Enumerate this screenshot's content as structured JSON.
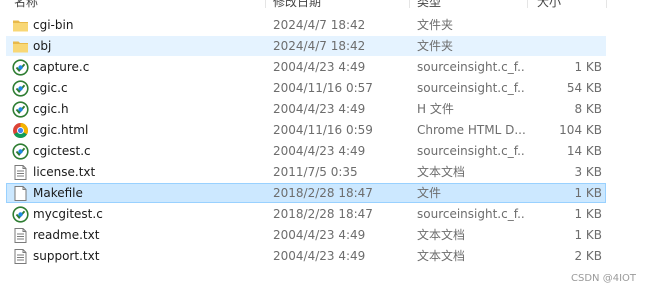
{
  "header": {
    "name": "名称",
    "date": "修改日期",
    "type": "类型",
    "size": "大小"
  },
  "files": [
    {
      "name": "cgi-bin",
      "date": "2024/4/7 18:42",
      "type": "文件夹",
      "size": "",
      "icon": "folder-icon"
    },
    {
      "name": "obj",
      "date": "2024/4/7 18:42",
      "type": "文件夹",
      "size": "",
      "icon": "folder-icon",
      "state": "hover"
    },
    {
      "name": "capture.c",
      "date": "2004/4/23 4:49",
      "type": "sourceinsight.c_f...",
      "size": "1 KB",
      "icon": "source-file-icon"
    },
    {
      "name": "cgic.c",
      "date": "2004/11/16 0:57",
      "type": "sourceinsight.c_f...",
      "size": "54 KB",
      "icon": "source-file-icon"
    },
    {
      "name": "cgic.h",
      "date": "2004/4/23 4:49",
      "type": "H 文件",
      "size": "8 KB",
      "icon": "source-file-icon"
    },
    {
      "name": "cgic.html",
      "date": "2004/11/16 0:59",
      "type": "Chrome HTML D...",
      "size": "104 KB",
      "icon": "chrome-icon"
    },
    {
      "name": "cgictest.c",
      "date": "2004/4/23 4:49",
      "type": "sourceinsight.c_f...",
      "size": "14 KB",
      "icon": "source-file-icon"
    },
    {
      "name": "license.txt",
      "date": "2011/7/5 0:35",
      "type": "文本文档",
      "size": "3 KB",
      "icon": "text-file-icon"
    },
    {
      "name": "Makefile",
      "date": "2018/2/28 18:47",
      "type": "文件",
      "size": "1 KB",
      "icon": "blank-file-icon",
      "state": "selected"
    },
    {
      "name": "mycgitest.c",
      "date": "2018/2/28 18:47",
      "type": "sourceinsight.c_f...",
      "size": "1 KB",
      "icon": "source-file-icon"
    },
    {
      "name": "readme.txt",
      "date": "2004/4/23 4:49",
      "type": "文本文档",
      "size": "1 KB",
      "icon": "text-file-icon"
    },
    {
      "name": "support.txt",
      "date": "2004/4/23 4:49",
      "type": "文本文档",
      "size": "2 KB",
      "icon": "text-file-icon"
    }
  ],
  "watermark": "CSDN @4IOT",
  "colors": {
    "hover": "#e5f3ff",
    "selected": "#cce8ff",
    "selected_border": "#99d1ff",
    "folder": "#f8d775"
  }
}
